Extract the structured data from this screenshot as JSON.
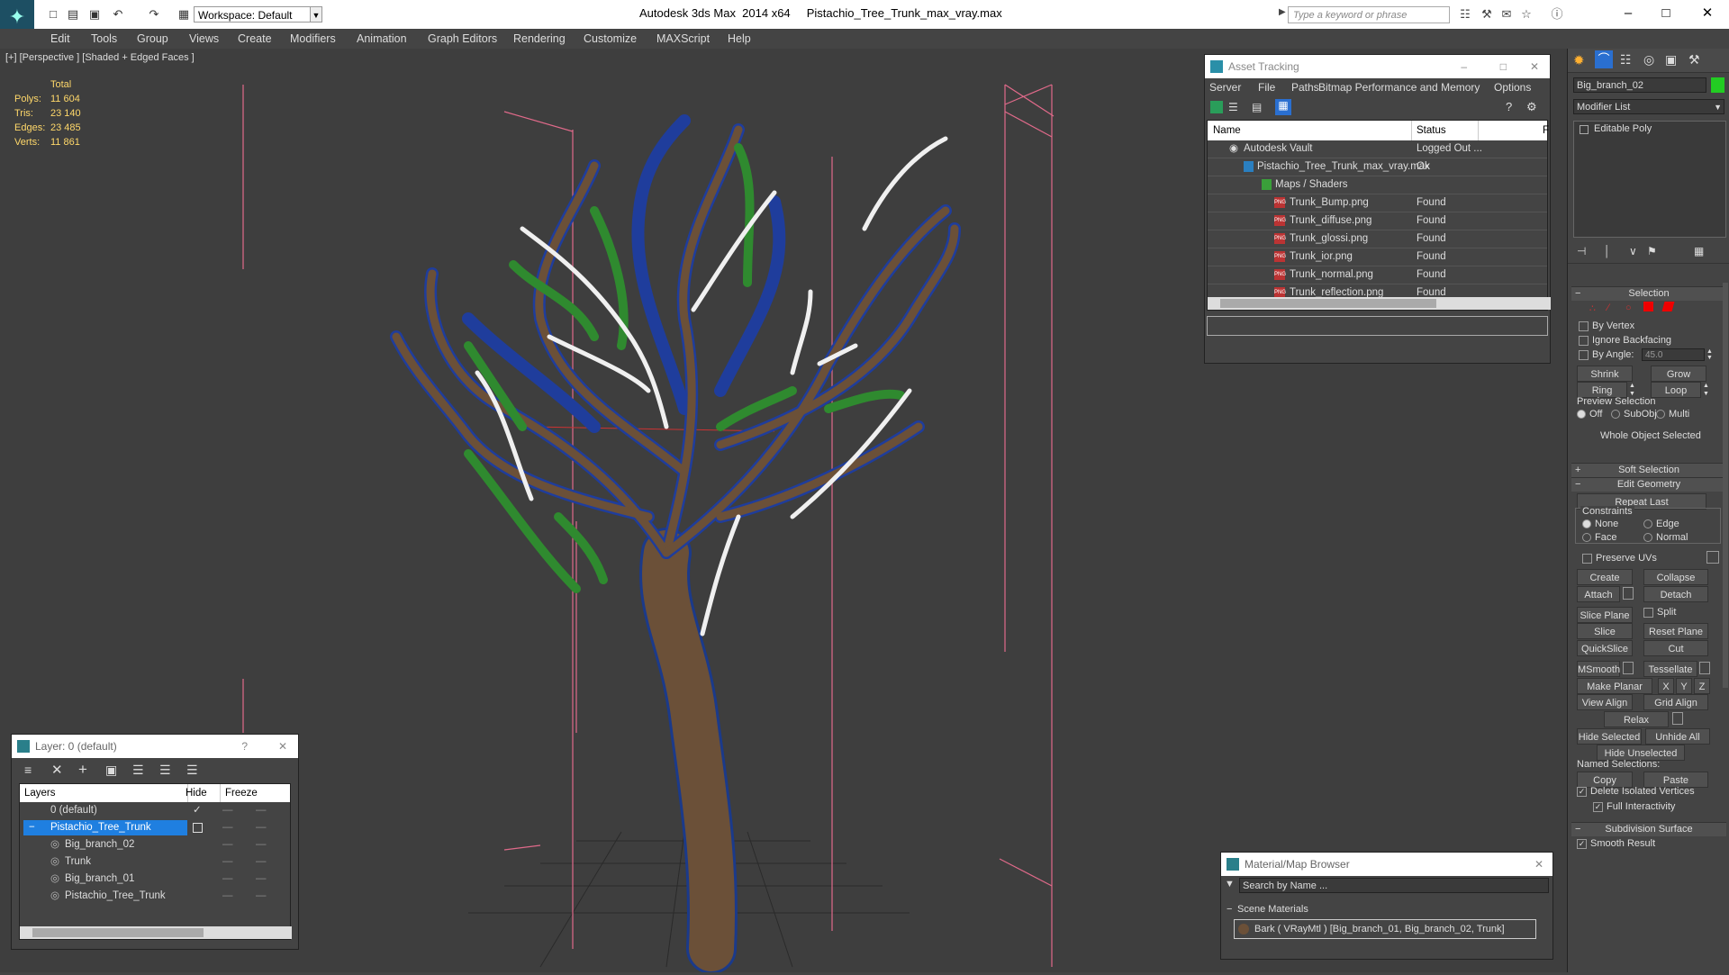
{
  "window": {
    "app_title": "Autodesk 3ds Max  2014 x64",
    "file_title": "Pistachio_Tree_Trunk_max_vray.max",
    "workspace": "Workspace: Default",
    "search_placeholder": "Type a keyword or phrase"
  },
  "menu": [
    "Edit",
    "Tools",
    "Group",
    "Views",
    "Create",
    "Modifiers",
    "Animation",
    "Graph Editors",
    "Rendering",
    "Customize",
    "MAXScript",
    "Help"
  ],
  "viewport": {
    "label": "[+] [Perspective ] [Shaded + Edged Faces ]",
    "stats_header": "Total",
    "stats": [
      {
        "label": "Polys:",
        "value": "11 604"
      },
      {
        "label": "Tris:",
        "value": "23 140"
      },
      {
        "label": "Edges:",
        "value": "23 485"
      },
      {
        "label": "Verts:",
        "value": "11 861"
      }
    ]
  },
  "asset_tracking": {
    "title": "Asset Tracking",
    "menu": [
      "Server",
      "File",
      "Paths",
      "Bitmap Performance and Memory",
      "Options"
    ],
    "columns": {
      "name": "Name",
      "status": "Status",
      "extra": "F"
    },
    "rows": [
      {
        "name": "Autodesk Vault",
        "status": "Logged Out ...",
        "indent": 1
      },
      {
        "name": "Pistachio_Tree_Trunk_max_vray.max",
        "status": "Ok",
        "indent": 2
      },
      {
        "name": "Maps / Shaders",
        "status": "",
        "indent": 3
      },
      {
        "name": "Trunk_Bump.png",
        "status": "Found",
        "indent": 4
      },
      {
        "name": "Trunk_diffuse.png",
        "status": "Found",
        "indent": 4
      },
      {
        "name": "Trunk_glossi.png",
        "status": "Found",
        "indent": 4
      },
      {
        "name": "Trunk_ior.png",
        "status": "Found",
        "indent": 4
      },
      {
        "name": "Trunk_normal.png",
        "status": "Found",
        "indent": 4
      },
      {
        "name": "Trunk_reflection.png",
        "status": "Found",
        "indent": 4
      }
    ]
  },
  "layer_panel": {
    "title": "Layer: 0 (default)",
    "help": "?",
    "columns": {
      "layers": "Layers",
      "hide": "Hide",
      "freeze": "Freeze"
    },
    "rows": [
      {
        "name": "0 (default)",
        "indent": 1
      },
      {
        "name": "Pistachio_Tree_Trunk",
        "indent": 1
      },
      {
        "name": "Big_branch_02",
        "indent": 2
      },
      {
        "name": "Trunk",
        "indent": 2
      },
      {
        "name": "Big_branch_01",
        "indent": 2
      },
      {
        "name": "Pistachio_Tree_Trunk",
        "indent": 2
      }
    ]
  },
  "material_browser": {
    "title": "Material/Map Browser",
    "search_placeholder": "Search by Name ...",
    "section": "Scene Materials",
    "item": "Bark  ( VRayMtl )  [Big_branch_01, Big_branch_02, Trunk]"
  },
  "command_panel": {
    "object_name": "Big_branch_02",
    "object_color": "#22cc22",
    "modifier_list": "Modifier List",
    "stack_item": "Editable Poly",
    "selection": {
      "title": "Selection",
      "by_vertex": "By Vertex",
      "ignore_backfacing": "Ignore Backfacing",
      "by_angle": "By Angle:",
      "angle_value": "45.0",
      "shrink": "Shrink",
      "grow": "Grow",
      "ring": "Ring",
      "loop": "Loop",
      "preview_selection": "Preview Selection",
      "off": "Off",
      "subobj": "SubObj",
      "multi": "Multi",
      "whole_object": "Whole Object Selected"
    },
    "soft_selection": "Soft Selection",
    "edit_geometry": {
      "title": "Edit Geometry",
      "repeat_last": "Repeat Last",
      "constraints": "Constraints",
      "none": "None",
      "edge": "Edge",
      "face": "Face",
      "normal": "Normal",
      "preserve_uvs": "Preserve UVs",
      "create": "Create",
      "collapse": "Collapse",
      "attach": "Attach",
      "detach": "Detach",
      "slice_plane": "Slice Plane",
      "split": "Split",
      "slice": "Slice",
      "reset_plane": "Reset Plane",
      "quickslice": "QuickSlice",
      "cut": "Cut",
      "msmooth": "MSmooth",
      "tessellate": "Tessellate",
      "make_planar": "Make Planar",
      "x": "X",
      "y": "Y",
      "z": "Z",
      "view_align": "View Align",
      "grid_align": "Grid Align",
      "relax": "Relax",
      "hide_selected": "Hide Selected",
      "unhide_all": "Unhide All",
      "hide_unselected": "Hide Unselected",
      "named_selections": "Named Selections:",
      "copy": "Copy",
      "paste": "Paste",
      "delete_isolated": "Delete Isolated Vertices",
      "full_interactivity": "Full Interactivity"
    },
    "subdivision_surface": "Subdivision Surface",
    "smooth_result": "Smooth Result"
  }
}
